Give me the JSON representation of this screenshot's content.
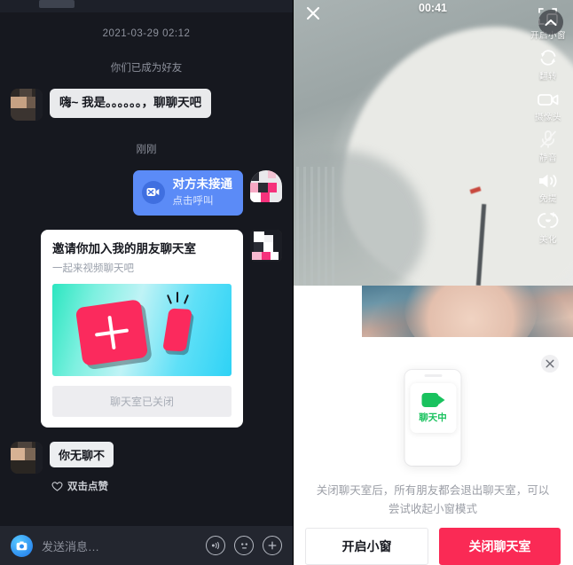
{
  "chat": {
    "system_time": "2021-03-29 02:12",
    "system_note": "你们已成为好友",
    "incoming_message": "嗨~ 我是。。。。。。，聊聊天吧",
    "relative_time": "刚刚",
    "call_bubble": {
      "title": "对方未接通",
      "subtitle": "点击呼叫",
      "icon": "video-call-off-icon",
      "color": "#5b8bf7"
    },
    "invite_card": {
      "title": "邀请你加入我的朋友聊天室",
      "subtitle": "一起来视频聊天吧",
      "footer_status": "聊天室已关闭",
      "art_icon": "plus-card-icon"
    },
    "reply_message": "你无聊不",
    "like_hint": "双击点赞",
    "like_icon": "heart-icon",
    "input": {
      "placeholder": "发送消息…",
      "camera_icon": "camera-icon",
      "voice_icon": "voice-wave-icon",
      "emoji_icon": "emoji-face-icon",
      "plus_icon": "plus-icon"
    }
  },
  "video": {
    "timer": "00:41",
    "close_icon": "close-x-icon",
    "collapse_icon": "chevron-up-icon",
    "controls": [
      {
        "label": "开启小窗",
        "icon": "picture-in-picture-icon"
      },
      {
        "label": "翻转",
        "icon": "flip-camera-icon"
      },
      {
        "label": "摄像头",
        "icon": "camera-video-icon"
      },
      {
        "label": "静音",
        "icon": "mic-muted-icon"
      },
      {
        "label": "免提",
        "icon": "speaker-icon"
      },
      {
        "label": "美化",
        "icon": "beautify-icon"
      }
    ]
  },
  "sheet": {
    "close_icon": "close-icon",
    "phone": {
      "badge_label": "聊天中",
      "badge_icon": "video-camera-icon",
      "badge_color": "#19c25e"
    },
    "description": "关闭聊天室后，所有朋友都会退出聊天室，可以尝试收起小窗模式",
    "buttons": {
      "secondary": "开启小窗",
      "primary": "关闭聊天室",
      "primary_color": "#fa2a55"
    }
  }
}
